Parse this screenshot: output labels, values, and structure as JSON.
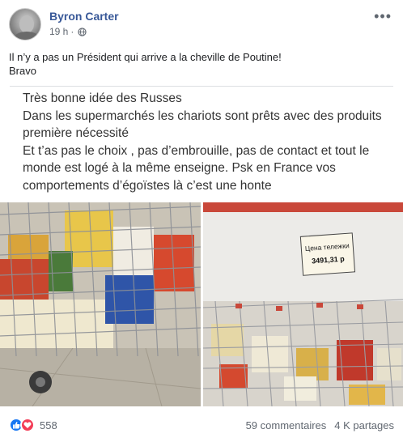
{
  "post": {
    "author": "Byron Carter",
    "time": "19 h",
    "separator": "·",
    "text_line1": "Il n’y a pas un Président qui arrive a la cheville de Poutine!",
    "text_line2": "Bravo",
    "shared_text": "Très bonne idée des Russes\nDans les supermarchés les chariots sont prêts avec des produits première nécessité\nEt t’as pas le choix , pas d’embrouille, pas de contact et tout le monde est logé à la même enseigne. Psk en France vos comportements d’égoïstes là c’est une honte"
  },
  "photo_right": {
    "sign_line1": "Цена тележки",
    "sign_line2": "3491,31 р"
  },
  "footer": {
    "reaction_count": "558",
    "comments": "59 commentaires",
    "shares": "4 K partages"
  },
  "icons": {
    "more": "more-options-icon",
    "privacy": "globe-icon",
    "like": "like-reaction-icon",
    "love": "love-reaction-icon"
  },
  "colors": {
    "author_link": "#385898",
    "like_blue": "#1877f2",
    "love_red": "#f33e58"
  }
}
